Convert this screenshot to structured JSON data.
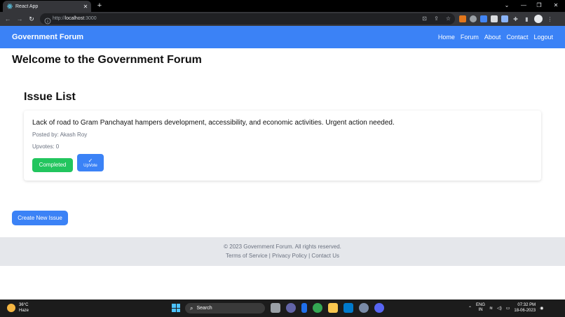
{
  "browser": {
    "tab_title": "React App",
    "tab_close": "✕",
    "new_tab": "+",
    "url_scheme": "http://",
    "url_host": "localhost",
    "url_port": ":3000",
    "colors": {
      "tabstrip": "#000000",
      "toolbar": "#35363a",
      "omnibox": "#202124"
    }
  },
  "navbar": {
    "brand": "Government Forum",
    "links": [
      "Home",
      "Forum",
      "About",
      "Contact",
      "Logout"
    ],
    "color": "#3b82f6"
  },
  "page": {
    "title": "Welcome to the Government Forum",
    "section_title": "Issue List"
  },
  "issues": [
    {
      "description": "Lack of road to Gram Panchayat hampers development, accessibility, and economic activities. Urgent action needed.",
      "posted_by": "Posted by: Akash Roy",
      "upvotes": "Upvotes: 0",
      "status_button": "Completed",
      "upvote_button": "UpVote",
      "upvote_icon": "✓"
    }
  ],
  "actions": {
    "create_issue": "Create New Issue"
  },
  "footer": {
    "copyright": "© 2023 Government Forum. All rights reserved.",
    "links": [
      "Terms of Service",
      "Privacy Policy",
      "Contact Us"
    ],
    "separator": " | "
  },
  "taskbar": {
    "temperature": "36°C",
    "condition": "Haze",
    "search_placeholder": "Search",
    "lang_top": "ENG",
    "lang_bottom": "IN",
    "time": "07:32 PM",
    "date": "18-06-2023"
  }
}
